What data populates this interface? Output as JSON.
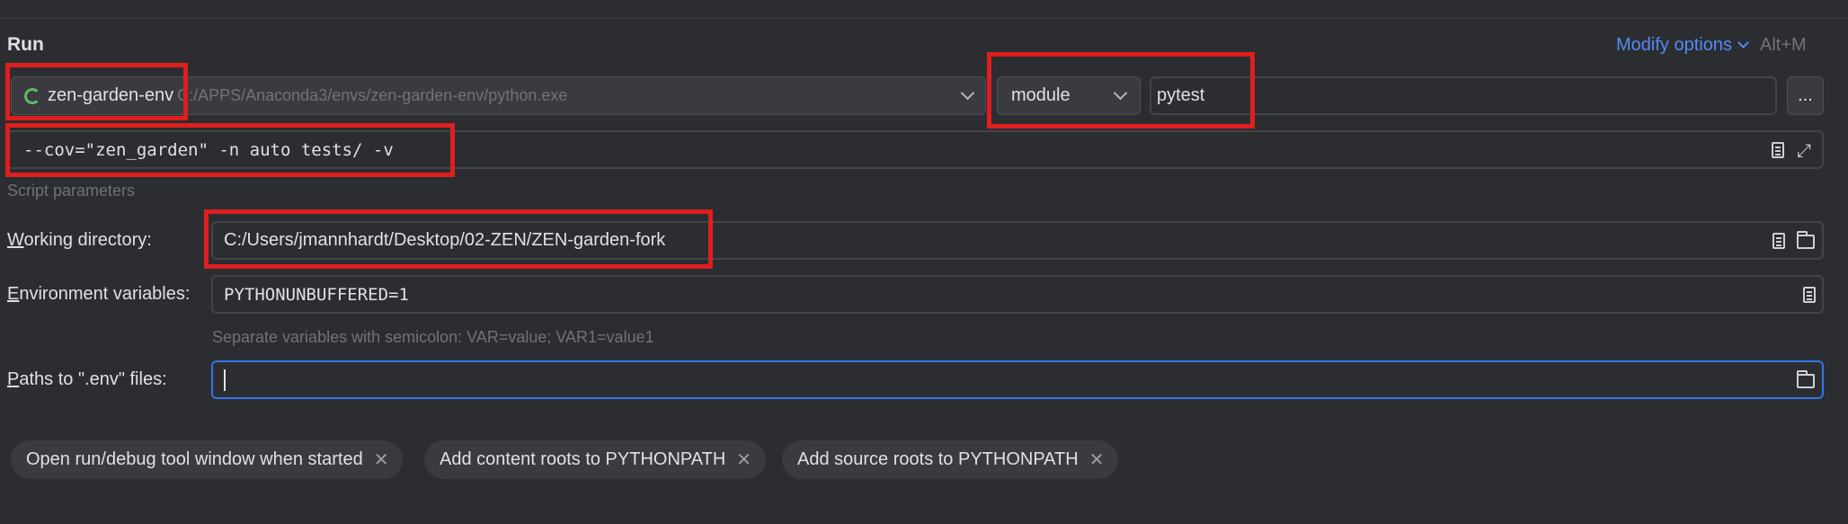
{
  "section": {
    "title": "Run",
    "modify_options_label": "Modify options",
    "modify_options_shortcut": "Alt+M"
  },
  "interpreter": {
    "name": "zen-garden-env",
    "path": "C:/APPS/Anaconda3/envs/zen-garden-env/python.exe"
  },
  "run_target": {
    "type": "module",
    "value": "pytest",
    "more_label": "..."
  },
  "script_parameters": {
    "value": "--cov=\"zen_garden\" -n auto tests/ -v",
    "hint": "Script parameters"
  },
  "working_directory": {
    "label_prefix": "W",
    "label_rest": "orking directory:",
    "value": "C:/Users/jmannhardt/Desktop/02-ZEN/ZEN-garden-fork"
  },
  "environment_variables": {
    "label_prefix": "E",
    "label_rest": "nvironment variables:",
    "value": "PYTHONUNBUFFERED=1",
    "hint": "Separate variables with semicolon: VAR=value; VAR1=value1"
  },
  "dotenv_paths": {
    "label_prefix": "P",
    "label_rest": "aths to \".env\" files:",
    "value": ""
  },
  "option_chips": [
    {
      "label": "Open run/debug tool window when started"
    },
    {
      "label": "Add content roots to PYTHONPATH"
    },
    {
      "label": "Add source roots to PYTHONPATH"
    }
  ],
  "colors": {
    "background": "#2b2d30",
    "field_border": "#43454a",
    "focus_border": "#3574f0",
    "link": "#548af7",
    "highlight": "#e01e1e",
    "spinner": "#5fb865"
  },
  "icons": [
    "spinner-icon",
    "chevron-down-icon",
    "document-icon",
    "expand-icon",
    "folder-icon",
    "close-icon"
  ]
}
